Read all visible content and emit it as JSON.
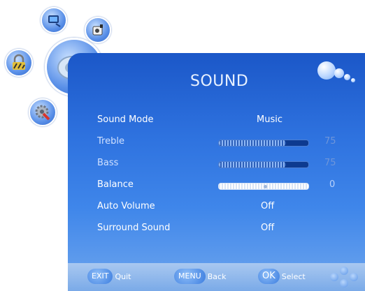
{
  "menu": {
    "title": "SOUND",
    "icons": [
      "picture-icon",
      "channel-icon",
      "lock-icon",
      "sound-icon",
      "setup-icon"
    ]
  },
  "settings": [
    {
      "label": "Sound Mode",
      "value": "Music",
      "enabled": true
    },
    {
      "label": "Treble",
      "value": "75",
      "level": 75,
      "enabled": false
    },
    {
      "label": "Bass",
      "value": "75",
      "level": 75,
      "enabled": false
    },
    {
      "label": "Balance",
      "value": "0",
      "level": 0,
      "enabled": true
    },
    {
      "label": "Auto Volume",
      "value": "Off",
      "enabled": true
    },
    {
      "label": "Surround Sound",
      "value": "Off",
      "enabled": true
    }
  ],
  "footer": {
    "exit_key": "EXIT",
    "exit_label": "Quit",
    "menu_key": "MENU",
    "menu_label": "Back",
    "ok_key": "OK",
    "ok_label": "Select"
  },
  "colors": {
    "panel": "#2e72df",
    "bar_track": "#0d3a8f",
    "dim_text": "#6f96da"
  }
}
